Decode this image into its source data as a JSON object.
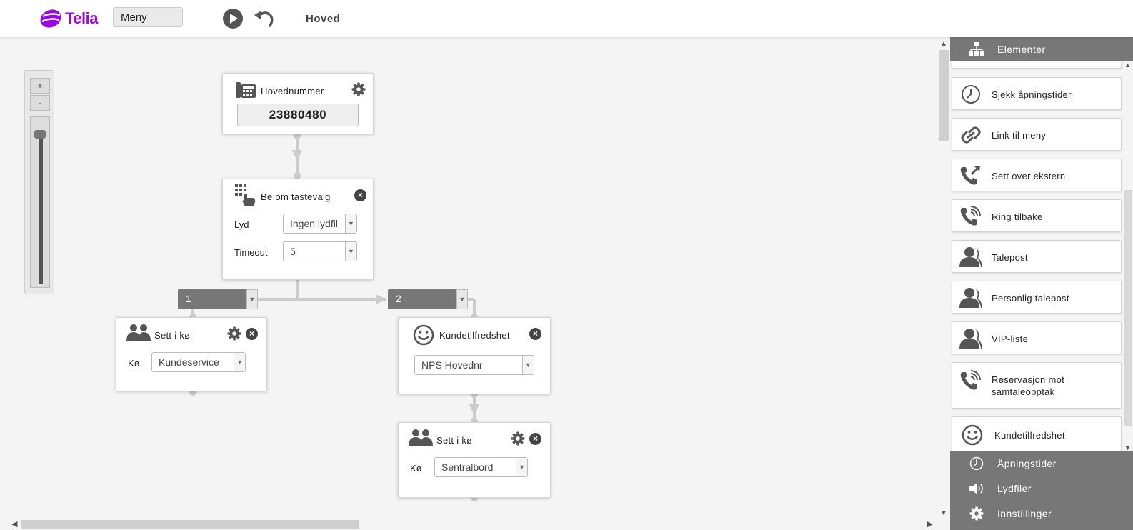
{
  "brand": {
    "name": "Telia",
    "color": "#990ae3"
  },
  "toolbar": {
    "menu_select_value": "Meny",
    "play_icon": "play-icon",
    "undo_icon": "undo-icon",
    "title": "Hoved"
  },
  "zoom": {
    "plus": "+",
    "minus": "-"
  },
  "nodes": {
    "main_number": {
      "title": "Hovednummer",
      "number": "23880480"
    },
    "ask_key": {
      "title": "Be om tastevalg",
      "sound_label": "Lyd",
      "sound_value": "Ingen lydfil",
      "timeout_label": "Timeout",
      "timeout_value": "5"
    },
    "branch1": {
      "label": "1"
    },
    "branch2": {
      "label": "2"
    },
    "queue1": {
      "title": "Sett i kø",
      "queue_label": "Kø",
      "queue_value": "Kundeservice"
    },
    "satisfaction": {
      "title": "Kundetilfredshet",
      "value": "NPS Hovednr"
    },
    "queue2": {
      "title": "Sett i kø",
      "queue_label": "Kø",
      "queue_value": "Sentralbord"
    }
  },
  "panel": {
    "elements_header": "Elementer",
    "items": [
      {
        "label": "Sjekk åpningstider",
        "icon": "clock-icon"
      },
      {
        "label": "Link til meny",
        "icon": "link-icon"
      },
      {
        "label": "Sett over ekstern",
        "icon": "phone-forward-icon"
      },
      {
        "label": "Ring tilbake",
        "icon": "phone-ring-icon"
      },
      {
        "label": "Talepost",
        "icon": "user-icon"
      },
      {
        "label": "Personlig talepost",
        "icon": "user-icon"
      },
      {
        "label": "VIP-liste",
        "icon": "user-icon"
      },
      {
        "label": "Reservasjon mot samtaleopptak",
        "icon": "phone-ring-icon"
      },
      {
        "label": "Kundetilfredshet",
        "icon": "smiley-icon"
      }
    ],
    "footer": [
      {
        "label": "Åpningstider",
        "icon": "clock-icon"
      },
      {
        "label": "Lydfiler",
        "icon": "speaker-icon"
      },
      {
        "label": "Innstillinger",
        "icon": "gear-icon"
      }
    ]
  }
}
